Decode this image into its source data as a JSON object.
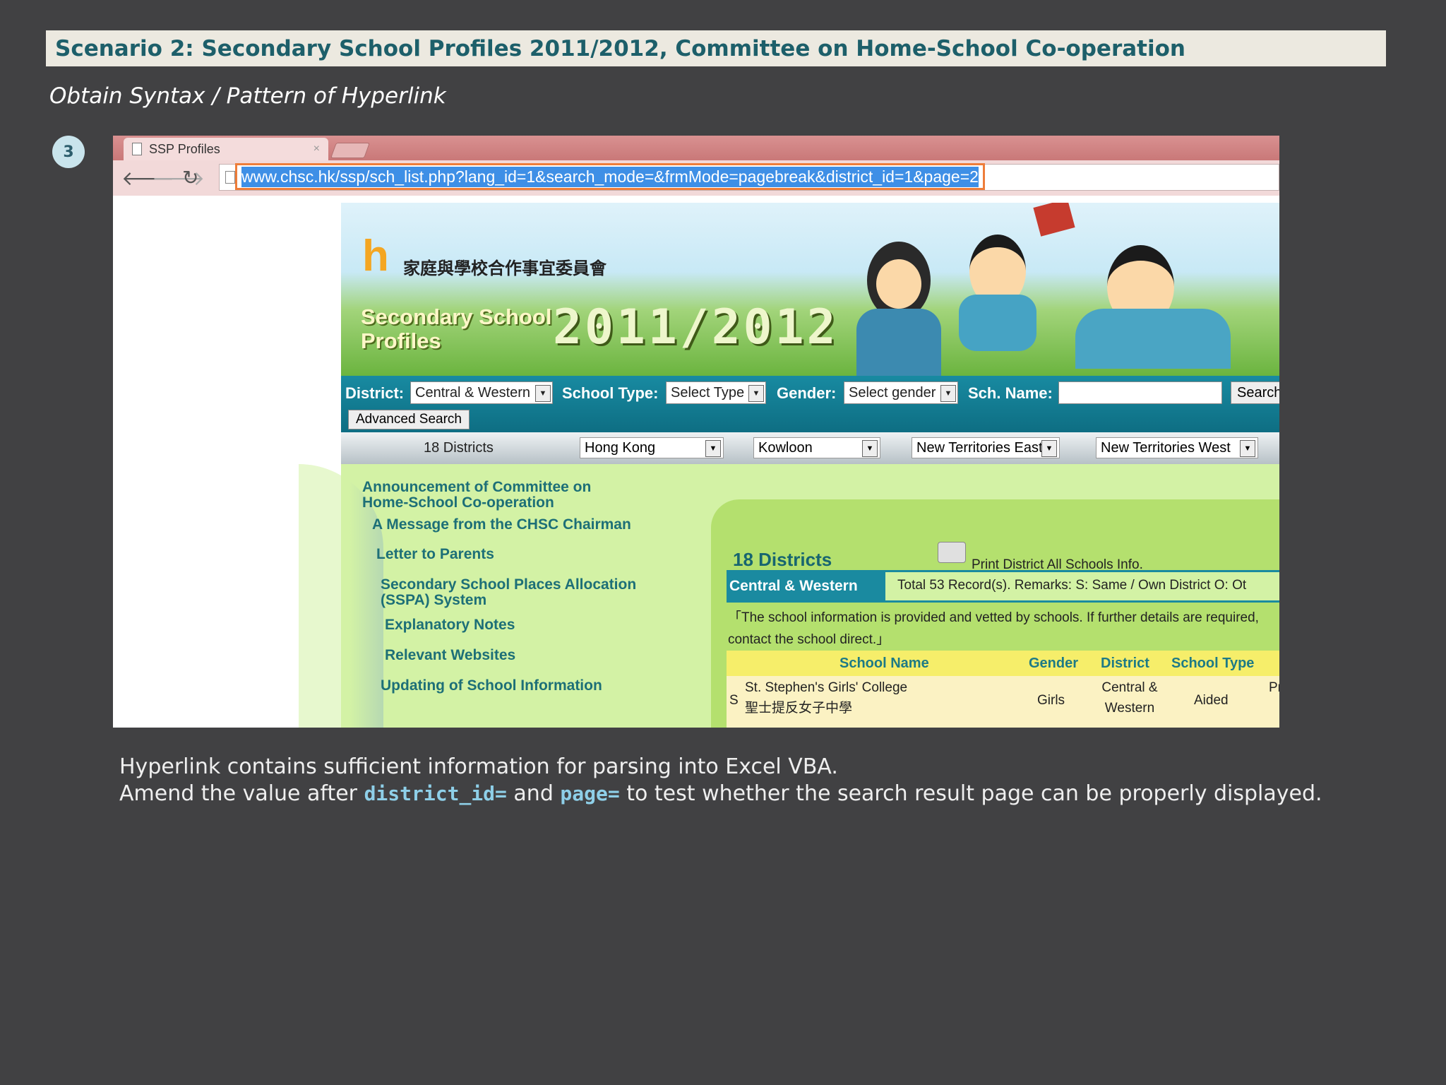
{
  "slide": {
    "title": "Scenario 2: Secondary School Profiles 2011/2012, Committee on Home-School Co-operation",
    "subtitle": "Obtain Syntax / Pattern of Hyperlink",
    "step_number": "3"
  },
  "browser": {
    "tab_title": "SSP Profiles",
    "tab_close": "×",
    "url": "www.chsc.hk/ssp/sch_list.php?lang_id=1&search_mode=&frmMode=pagebreak&district_id=1&page=2",
    "highlight_color": "#ee7d3a",
    "nav_icons": [
      "back-arrow-icon",
      "forward-arrow-icon",
      "reload-icon"
    ]
  },
  "site": {
    "logo_org": "家庭與學校合作事宜委員會",
    "banner_title": "Secondary School Profiles",
    "banner_year": "2011/2012",
    "search": {
      "district_label": "District:",
      "district_value": "Central & Western",
      "school_type_label": "School Type:",
      "school_type_value": "Select Type",
      "gender_label": "Gender:",
      "gender_value": "Select gender",
      "name_label": "Sch. Name:",
      "name_value": "",
      "search_button": "Search",
      "advanced_button": "Advanced Search"
    },
    "regions": {
      "all_label": "18 Districts",
      "selects": [
        "Hong Kong",
        "Kowloon",
        "New Territories East",
        "New Territories West"
      ]
    },
    "left_nav": [
      "Announcement of Committee on Home-School Co-operation",
      "A Message from the CHSC Chairman",
      "Letter to Parents",
      "Secondary School Places Allocation (SSPA) System",
      "Explanatory Notes",
      "Relevant Websites",
      "Updating of School Information"
    ],
    "results": {
      "heading": "18 Districts",
      "print_link": "Print District All Schools Info.",
      "district_name": "Central & Western",
      "summary": "Total 53 Record(s).  Remarks: S: Same / Own District   O: Ot",
      "notice": "「The school information is provided and vetted by schools. If further details are required, contact the school direct.」",
      "columns": [
        "School Name",
        "Gender",
        "District",
        "School Type"
      ],
      "rows": [
        {
          "prefix": "S",
          "name_en": "St. Stephen's Girls' College",
          "name_zh": "聖士提反女子中學",
          "gender": "Girls",
          "district": "Central & Western",
          "type": "Aided",
          "extra": "Pr"
        }
      ]
    }
  },
  "captions": {
    "line1": "Hyperlink contains sufficient information for parsing into Excel VBA.",
    "line2_a": "Amend the value after",
    "code1": "district_id=",
    "line2_b": "and",
    "code2": "page=",
    "line2_c": "to test whether the search result page can be properly displayed."
  }
}
